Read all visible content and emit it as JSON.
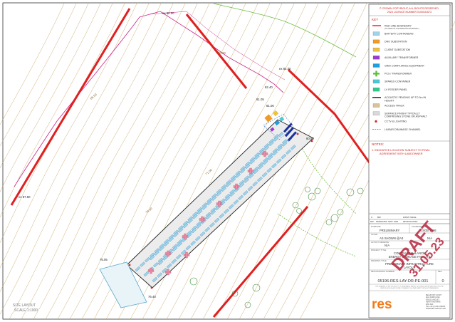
{
  "copyright": {
    "line1": "© CROWN COPYRIGHT, ALL RIGHTS RESERVED.",
    "line2": "2023 LICENCE NUMBER 0100031673"
  },
  "key": {
    "title": "KEY",
    "items": [
      {
        "label": "RED LINE BOUNDARY",
        "sub": "(OUTSIDE OF LINE DENOTES BOUNDARY)",
        "kind": "line",
        "color": "#e02020"
      },
      {
        "label": "BATTERY CONTAINERS",
        "kind": "box",
        "color": "#9fd3ea"
      },
      {
        "label": "DNO SUBSTATION",
        "kind": "box",
        "color": "#f29a26"
      },
      {
        "label": "CLIENT SUBSTATION",
        "kind": "box",
        "color": "#f0c23c"
      },
      {
        "label": "AUXILIARY TRANSFORMER",
        "kind": "box",
        "color": "#9b3ad1"
      },
      {
        "label": "GRID COMPLIANCE EQUIPMENT",
        "kind": "box",
        "color": "#1f9fe0"
      },
      {
        "label": "PCS / TRANSFORMER",
        "kind": "plus",
        "color": "#5cc13a"
      },
      {
        "label": "SPARES CONTAINER",
        "kind": "box",
        "color": "#4cc7d6"
      },
      {
        "label": "LV FEEDER PANEL",
        "kind": "box",
        "color": "#2fc98f"
      },
      {
        "label": "ACOUSTIC FENCING UP TO 3m IN HEIGHT",
        "kind": "line",
        "color": "#222222"
      },
      {
        "label": "ACCESS TRACK",
        "kind": "box",
        "color": "#d8c49a"
      },
      {
        "label": "SURFACE FINISH TYPICALLY COMPRISING STONE OR ASPHALT",
        "kind": "box",
        "color": "#d9d9d9"
      },
      {
        "label": "CCTV & LIGHTING",
        "kind": "dot",
        "color": "#e02020"
      },
      {
        "label": "LINEAR DRAINAGE CHANNEL",
        "kind": "dash",
        "color": "#3a78c2"
      }
    ]
  },
  "notes": {
    "title": "NOTES:",
    "items": [
      "1.  INDICATIVE LOCATION SUBJECT TO FINAL AGREEMENT WITH LANDOWNER"
    ]
  },
  "title_block": {
    "rev_header": [
      "C",
      "BM",
      "",
      "",
      "FIRST ISSUE"
    ],
    "rev_cols": [
      "REV",
      "DRAWN",
      "CHKD",
      "APPD",
      "DATE",
      "REVISION NOTES"
    ],
    "purpose_label": "PURPOSE",
    "purpose": "PRELIMINARY",
    "coords_label": "COORDINATES",
    "coords": "OSGB 1936",
    "scale_label": "SCALE",
    "scale": "AS SHOWN  @A3",
    "scale_extra": "N/A",
    "layout_label": "LAYOUT DRAWING",
    "layout": "N/A",
    "project_label": "PROJECT TITLE",
    "project_line1": "CONTRACT BALANCE",
    "project_line2": "ENERGY STORAGE FACILITY",
    "drawing_label": "DRAWING TITLE",
    "drawing_line1": "PRELIMINARY INFRASTRUCTURE",
    "drawing_line2": "LAYOUT",
    "number_label": "RES DRAWING NUMBER",
    "rev_label": "REV",
    "number": "05196-RES-LAY-DR-PE-001",
    "rev": "0",
    "disclaimer": "THIS DRAWING IS THE PROPERTY OF RENEWABLE ENERGY SYSTEMS LIMITED AND MUST NOT BE REPRODUCED IN ANY FORM OR PASSED TO A THIRD PARTY WITHOUT PERMISSION",
    "logo_text": "res",
    "address": [
      "BEAUFORT COURT",
      "EGG FARM LANE",
      "KINGS LANGLEY",
      "HERTFORDSHIRE",
      "WD4 8LR",
      "TEL +44 (0) 1923 299200",
      "WWW.RES-GROUP.COM"
    ]
  },
  "stamp": {
    "line1": "DRAFT",
    "line2": "31.05.23"
  },
  "map": {
    "site_layout_title": "SITE LAYOUT",
    "site_layout_scale": "SCALE 1:1000",
    "levels": [
      "ex 92.00",
      "ex 84.00",
      "ex 87.50",
      "82.40",
      "81.05",
      "81.00",
      "80.53",
      "76.05",
      "76.40"
    ],
    "contour_labels": [
      "80.00",
      "86.00",
      "70.00",
      "71.00"
    ],
    "colors": {
      "boundary": "#e02020",
      "track": "#d0338f",
      "contour": "#c8a46a",
      "hedge": "#6cbf3c"
    }
  }
}
